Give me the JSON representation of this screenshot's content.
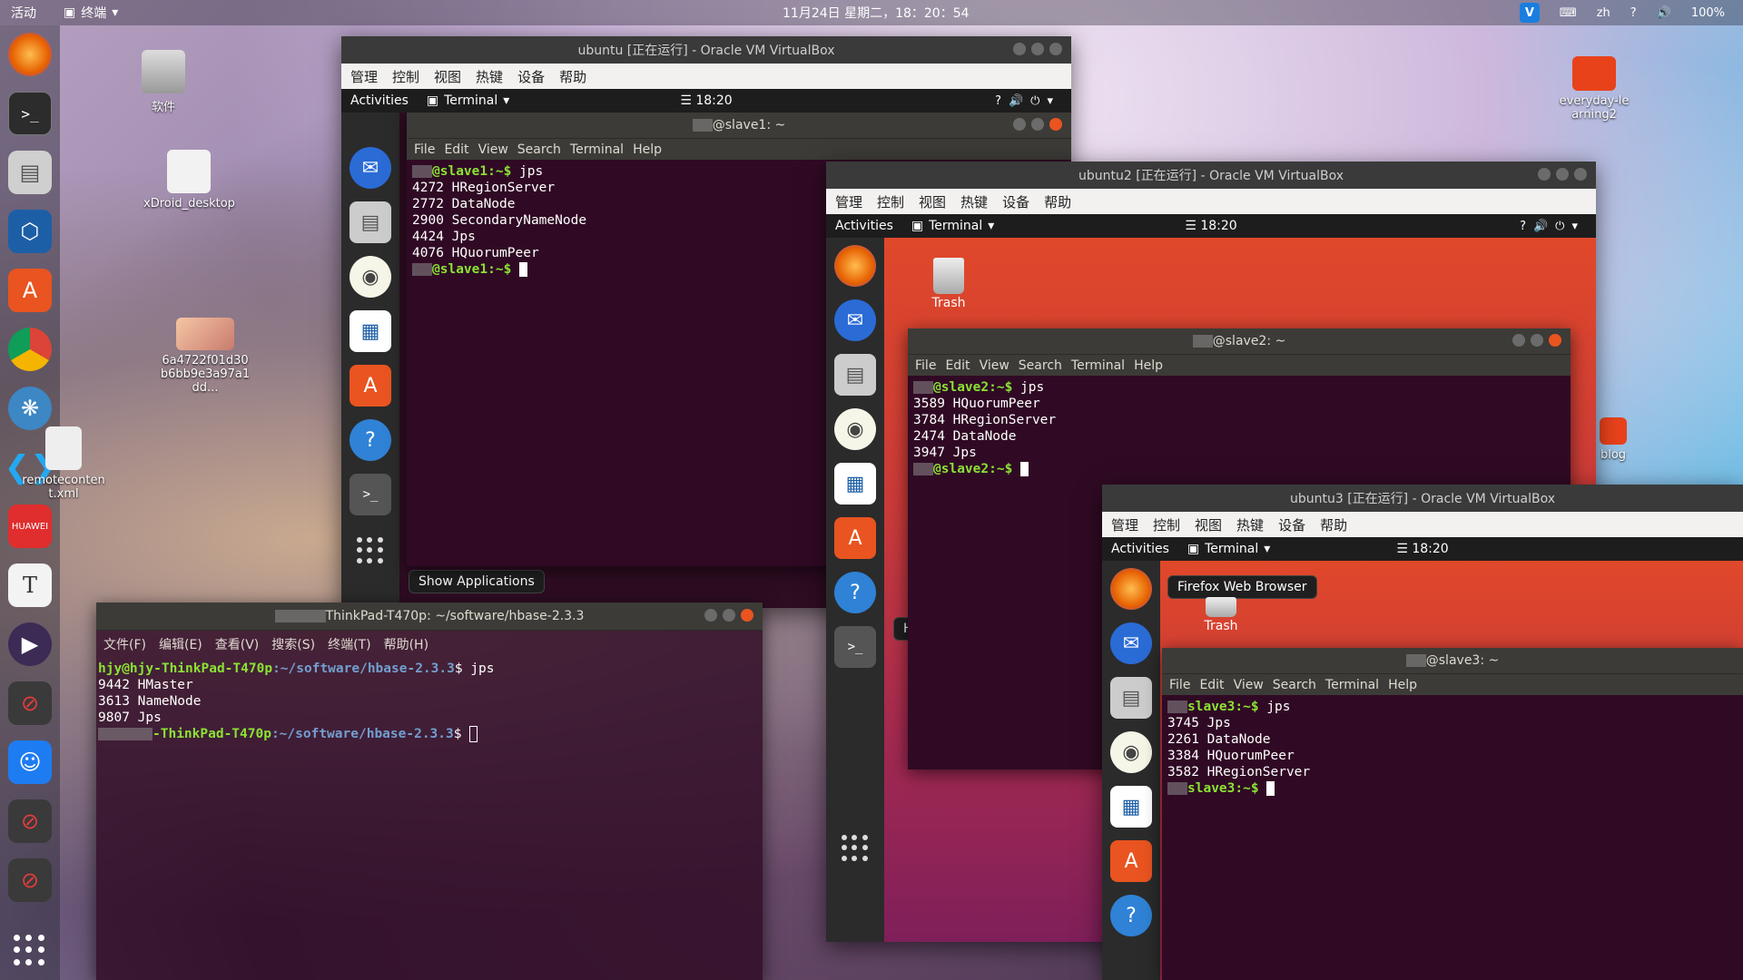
{
  "topbar": {
    "activities": "活动",
    "app": "终端",
    "clock": "11月24日 星期二，18：20：54",
    "lang": "zh",
    "battery": "100%"
  },
  "desktop": {
    "icons": [
      {
        "label": "软件"
      },
      {
        "label": "xDroid_desktop"
      },
      {
        "label": "6a4722f01d30b6bb9e3a97a1dd..."
      },
      {
        "label": "remotecontent.xml"
      },
      {
        "label": "everyday-learning2"
      },
      {
        "label": "blog"
      }
    ]
  },
  "vm1": {
    "title": "ubuntu [正在运行] - Oracle VM VirtualBox",
    "menu": [
      "管理",
      "控制",
      "视图",
      "热键",
      "设备",
      "帮助"
    ],
    "activities": "Activities",
    "terminal_label": "Terminal",
    "time": "18:20",
    "term_title": "@slave1: ~",
    "term_menu": [
      "File",
      "Edit",
      "View",
      "Search",
      "Terminal",
      "Help"
    ],
    "prompt": "@slave1:~$",
    "cmd": "jps",
    "lines": [
      "4272 HRegionServer",
      "2772 DataNode",
      "2900 SecondaryNameNode",
      "4424 Jps",
      "4076 HQuorumPeer"
    ],
    "tooltip": "Show Applications"
  },
  "vm2": {
    "title": "ubuntu2 [正在运行] - Oracle VM VirtualBox",
    "menu": [
      "管理",
      "控制",
      "视图",
      "热键",
      "设备",
      "帮助"
    ],
    "activities": "Activities",
    "terminal_label": "Terminal",
    "time": "18:20",
    "trash": "Trash",
    "term_title": "@slave2: ~",
    "term_menu": [
      "File",
      "Edit",
      "View",
      "Search",
      "Terminal",
      "Help"
    ],
    "prompt": "@slave2:~$",
    "cmd": "jps",
    "lines": [
      "3589 HQuorumPeer",
      "3784 HRegionServer",
      "2474 DataNode",
      "3947 Jps"
    ],
    "tooltip": "Help"
  },
  "vm3": {
    "title": "ubuntu3 [正在运行] - Oracle VM VirtualBox",
    "menu": [
      "管理",
      "控制",
      "视图",
      "热键",
      "设备",
      "帮助"
    ],
    "activities": "Activities",
    "terminal_label": "Terminal",
    "time": "18:20",
    "trash": "Trash",
    "term_title": "@slave3: ~",
    "term_menu": [
      "File",
      "Edit",
      "View",
      "Search",
      "Terminal",
      "Help"
    ],
    "prompt": "slave3:~$",
    "cmd": "jps",
    "lines": [
      "3745 Jps",
      "2261 DataNode",
      "3384 HQuorumPeer",
      "3582 HRegionServer"
    ],
    "tooltip": "Firefox Web Browser"
  },
  "host_term": {
    "title": "ThinkPad-T470p: ~/software/hbase-2.3.3",
    "menu": [
      "文件(F)",
      "编辑(E)",
      "查看(V)",
      "搜索(S)",
      "终端(T)",
      "帮助(H)"
    ],
    "prompt1_user": "hjy@hjy-ThinkPad-T470p",
    "prompt1_path": ":~/software/hbase-2.3.3",
    "cmd": "$ jps",
    "lines": [
      "9442 HMaster",
      "3613 NameNode",
      "9807 Jps"
    ],
    "prompt2_user": "-ThinkPad-T470p",
    "prompt2_path": ":~/software/hbase-2.3.3",
    "prompt2_end": "$"
  },
  "colors": {
    "ubuntu_orange": "#e95420",
    "terminal_bg": "#300a24",
    "prompt_green": "#8ae234",
    "path_blue": "#729fcf"
  }
}
